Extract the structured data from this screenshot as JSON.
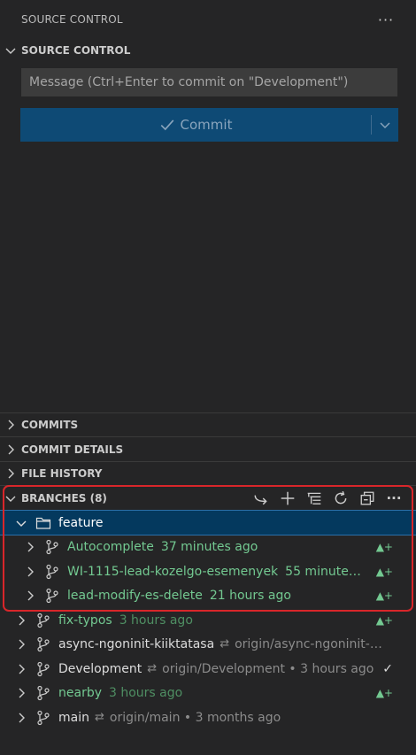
{
  "view": {
    "title": "SOURCE CONTROL"
  },
  "scm": {
    "section_title": "SOURCE CONTROL",
    "message_placeholder": "Message (Ctrl+Enter to commit on \"Development\")",
    "commit_label": "Commit"
  },
  "sections": {
    "commits": "COMMITS",
    "commit_details": "COMMIT DETAILS",
    "file_history": "FILE HISTORY",
    "branches": "BRANCHES (8)"
  },
  "folder": {
    "name": "feature"
  },
  "branches": [
    {
      "name": "Autocomplete",
      "desc": "37 minutes ago",
      "status": "▲+"
    },
    {
      "name": "WI-1115-lead-kozelgo-esemenyek",
      "desc": "55 minutes...",
      "status": "▲+"
    },
    {
      "name": "lead-modify-es-delete",
      "desc": "21 hours ago",
      "status": "▲+"
    },
    {
      "name": "fix-typos",
      "desc": "3 hours ago",
      "status": "▲+"
    },
    {
      "name": "async-ngoninit-kiiktatasa",
      "sync_icon": "⇄",
      "desc": "origin/async-ngoninit-kii...",
      "status": ""
    },
    {
      "name": "Development",
      "sync_icon": "⇄",
      "desc": "origin/Development • 3 hours ago",
      "status": "✓"
    },
    {
      "name": "nearby",
      "desc": "3 hours ago",
      "status": "▲+"
    },
    {
      "name": "main",
      "sync_icon": "⇄",
      "desc": "origin/main • 3 months ago",
      "status": ""
    }
  ],
  "colors": {
    "added": "#73c991",
    "accent": "#0e4a75",
    "highlight": "#d9262a"
  }
}
